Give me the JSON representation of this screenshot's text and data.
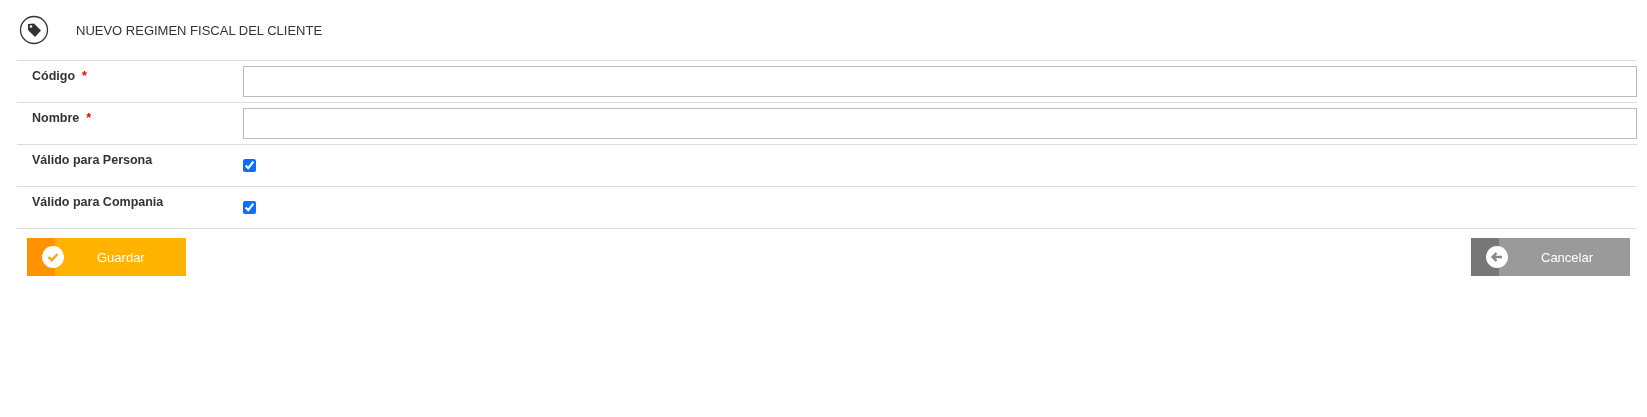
{
  "header": {
    "title": "NUEVO REGIMEN FISCAL DEL CLIENTE"
  },
  "fields": [
    {
      "kind": "text",
      "label": "Código",
      "required": true,
      "required_mark": "*"
    },
    {
      "kind": "text",
      "label": "Nombre",
      "required": true,
      "required_mark": "*"
    },
    {
      "kind": "checkbox",
      "label": "Válido para Persona",
      "checked": true
    },
    {
      "kind": "checkbox",
      "label": "Válido para Compania",
      "checked": true
    }
  ],
  "buttons": [
    {
      "kind": "save",
      "label": "Guardar"
    },
    {
      "kind": "cancel",
      "label": "Cancelar"
    }
  ]
}
